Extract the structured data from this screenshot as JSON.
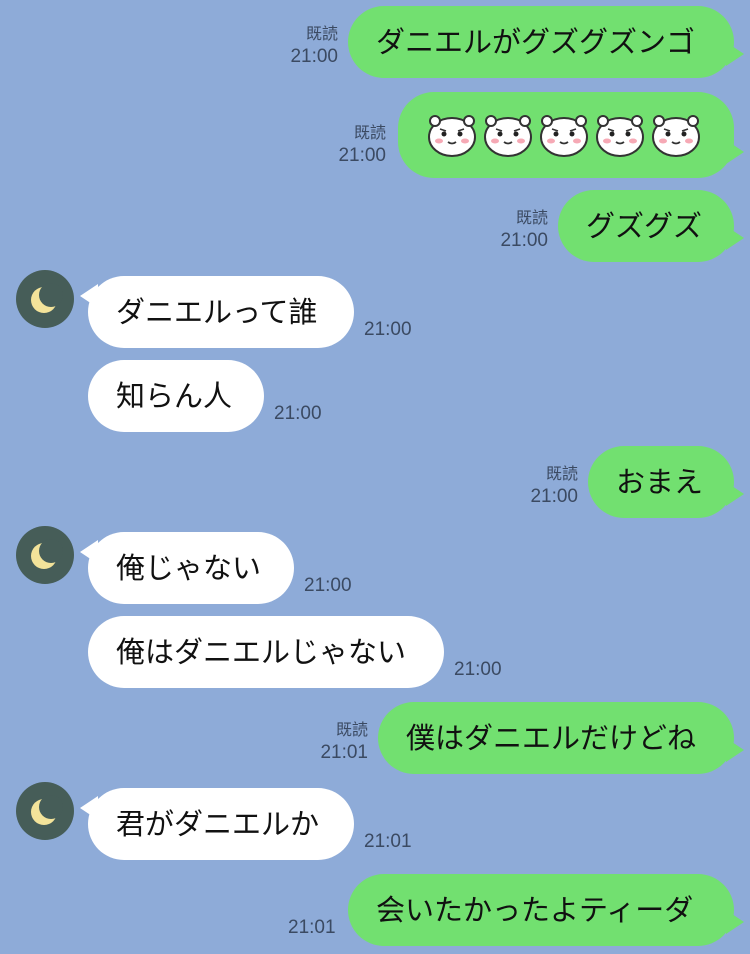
{
  "messages": [
    {
      "side": "sent",
      "text": "ダニエルがグズグズンゴ",
      "read": "既読",
      "time": "21:00"
    },
    {
      "side": "sent",
      "emoji": "hamster-face",
      "count": 5,
      "read": "既読",
      "time": "21:00"
    },
    {
      "side": "sent",
      "text": "グズグズ",
      "read": "既読",
      "time": "21:00"
    },
    {
      "side": "recv",
      "text": "ダニエルって誰",
      "time": "21:00"
    },
    {
      "side": "recv",
      "text": "知らん人",
      "time": "21:00"
    },
    {
      "side": "sent",
      "text": "おまえ",
      "read": "既読",
      "time": "21:00"
    },
    {
      "side": "recv",
      "text": "俺じゃない",
      "time": "21:00"
    },
    {
      "side": "recv",
      "text": "俺はダニエルじゃない",
      "time": "21:00"
    },
    {
      "side": "sent",
      "text": "僕はダニエルだけどね",
      "read": "既読",
      "time": "21:01"
    },
    {
      "side": "recv",
      "text": "君がダニエルか",
      "time": "21:01"
    },
    {
      "side": "sent",
      "text": "会いたかったよティーダ",
      "time": "21:01"
    }
  ],
  "colors": {
    "background": "#8eabd8",
    "sent_bubble": "#72e070",
    "recv_bubble": "#ffffff",
    "avatar_bg": "#465d58",
    "moon": "#f3e39a"
  },
  "avatar_icon": "crescent-moon-icon"
}
